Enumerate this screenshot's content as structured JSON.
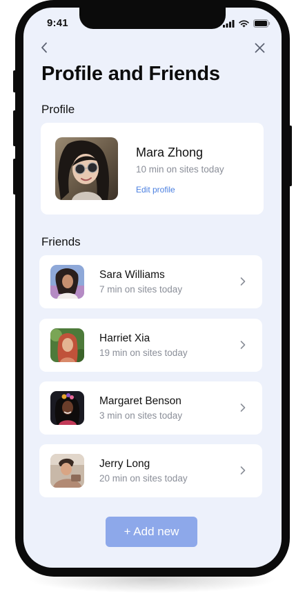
{
  "status_bar": {
    "time": "9:41",
    "icons": [
      "signal-icon",
      "wifi-icon",
      "battery-icon"
    ]
  },
  "nav": {
    "back_icon": "chevron-left-icon",
    "close_icon": "close-icon"
  },
  "page_title": "Profile and Friends",
  "profile": {
    "section_label": "Profile",
    "name": "Mara Zhong",
    "usage": "10 min on sites today",
    "edit_label": "Edit profile"
  },
  "friends": {
    "section_label": "Friends",
    "items": [
      {
        "name": "Sara Williams",
        "usage": "7 min on sites today"
      },
      {
        "name": "Harriet Xia",
        "usage": "19 min on sites today"
      },
      {
        "name": "Margaret Benson",
        "usage": "3 min on sites today"
      },
      {
        "name": "Jerry Long",
        "usage": "20 min on sites today"
      }
    ]
  },
  "add_button_label": "+ Add new",
  "colors": {
    "screen_background": "#edf1fb",
    "card_background": "#ffffff",
    "accent_link": "#4a7fe0",
    "add_button": "#8da8ea",
    "secondary_text": "#8a8e98"
  }
}
